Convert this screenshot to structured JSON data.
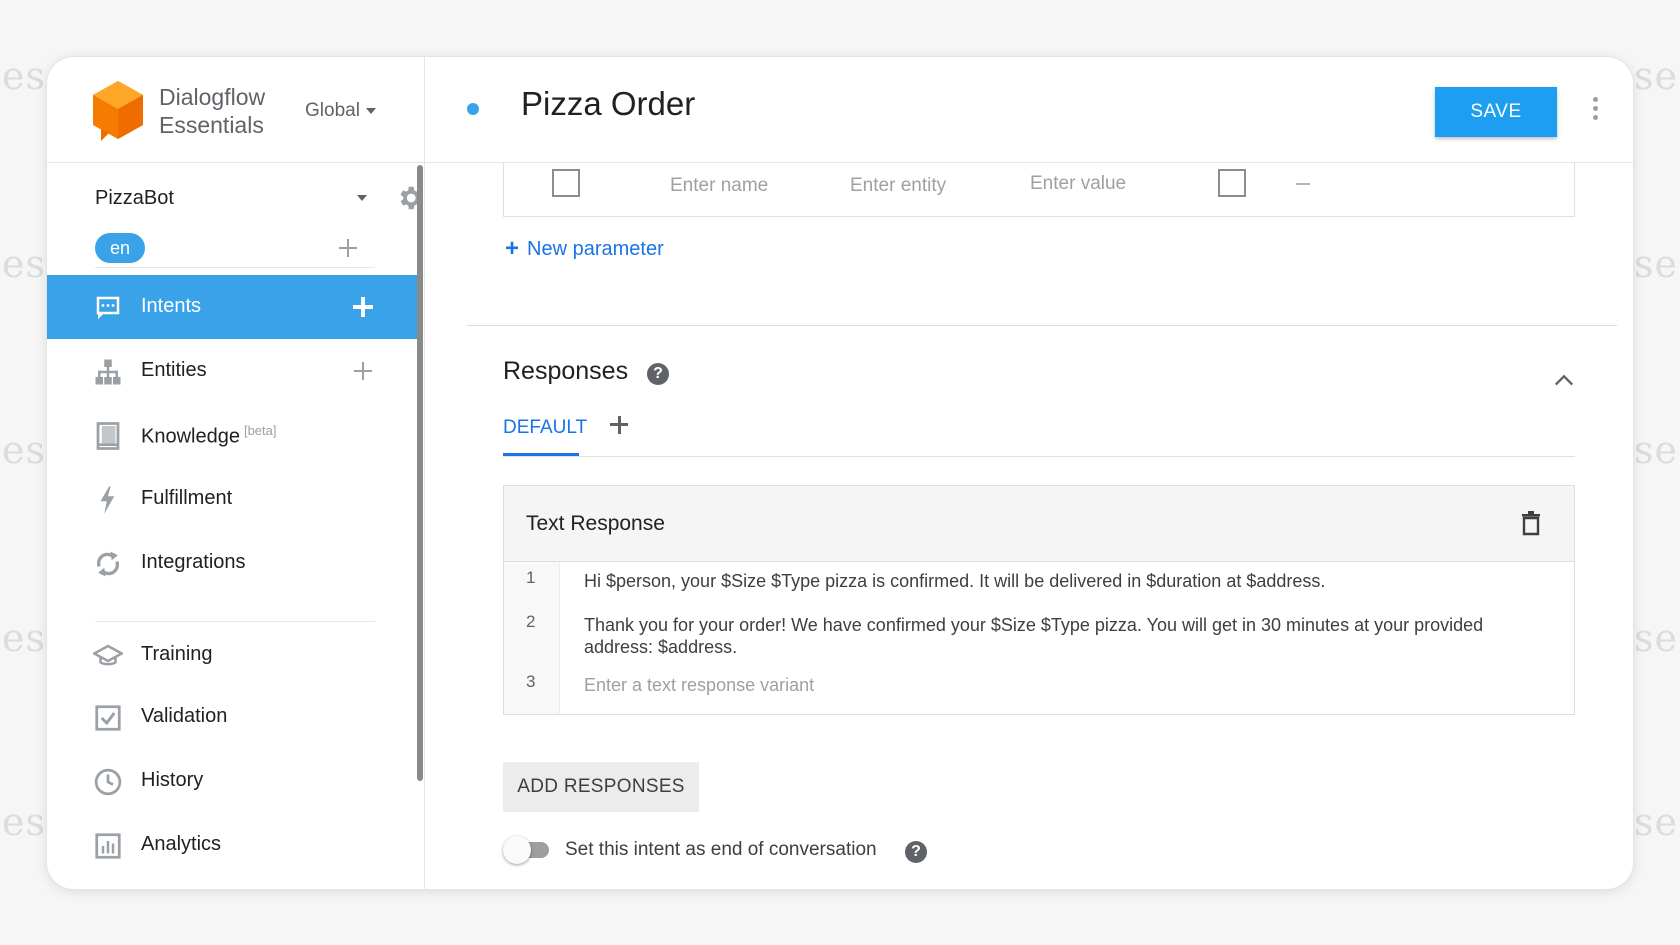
{
  "watermark": "ese",
  "sidebar": {
    "logo_line1": "Dialogflow",
    "logo_line2": "Essentials",
    "region": "Global",
    "agent_name": "PizzaBot",
    "language": "en",
    "nav": [
      {
        "label": "Intents",
        "icon": "intents-icon",
        "active": true
      },
      {
        "label": "Entities",
        "icon": "entities-icon"
      },
      {
        "label": "Knowledge",
        "badge": "[beta]",
        "icon": "knowledge-icon"
      },
      {
        "label": "Fulfillment",
        "icon": "fulfillment-icon"
      },
      {
        "label": "Integrations",
        "icon": "integrations-icon"
      },
      {
        "label": "Training",
        "icon": "training-icon"
      },
      {
        "label": "Validation",
        "icon": "validation-icon"
      },
      {
        "label": "History",
        "icon": "history-icon"
      },
      {
        "label": "Analytics",
        "icon": "analytics-icon"
      }
    ]
  },
  "header": {
    "title": "Pizza Order",
    "save_label": "SAVE"
  },
  "parameters": {
    "name_placeholder": "Enter name",
    "entity_placeholder": "Enter entity",
    "value_placeholder": "Enter value",
    "new_parameter_label": "New parameter"
  },
  "responses": {
    "title": "Responses",
    "tab_default": "DEFAULT",
    "card_title": "Text Response",
    "rows": [
      {
        "num": "1",
        "text": "Hi $person, your $Size $Type pizza is confirmed. It will be delivered in $duration at $address."
      },
      {
        "num": "2",
        "text": "Thank you for your order! We have confirmed your $Size $Type pizza. You will get in 30 minutes at your provided address: $address."
      },
      {
        "num": "3",
        "text": "Enter a text response variant"
      }
    ],
    "add_responses_label": "ADD RESPONSES",
    "end_conversation_label": "Set this intent as end of conversation"
  },
  "colors": {
    "accent": "#3aa2e8",
    "save": "#1e9ef0",
    "link": "#1a73e8",
    "logo": "#f57c00"
  }
}
